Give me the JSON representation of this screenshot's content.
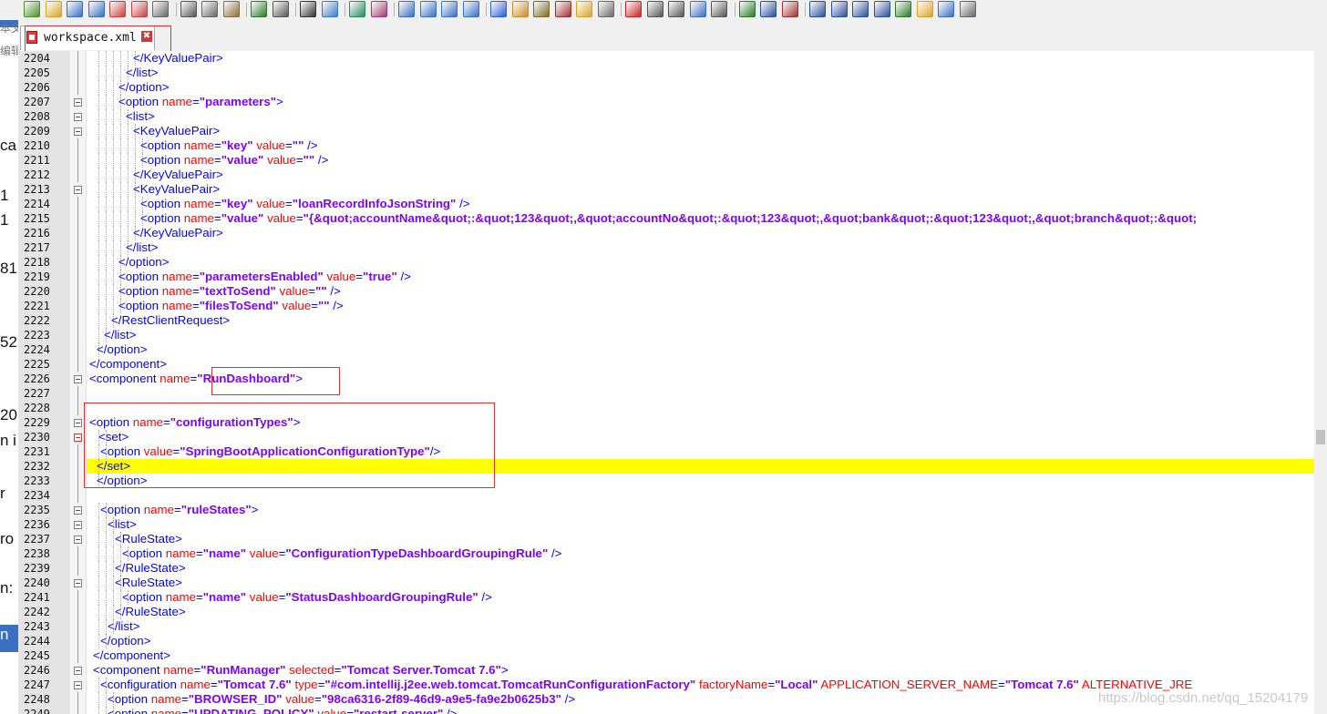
{
  "toolbar": {
    "icons": [
      "new-file-icon",
      "open-icon",
      "save-icon",
      "save-all-icon",
      "close-icon",
      "close-all-icon",
      "print-icon",
      "cut-icon",
      "copy-icon",
      "paste-icon",
      "undo-icon",
      "redo-icon",
      "find-icon",
      "replace-icon",
      "zoom-in-icon",
      "zoom-out-icon",
      "sync-v-icon",
      "sync-h-icon",
      "word-wrap-icon",
      "show-all-chars-icon",
      "indent-guide-icon",
      "udl-icon",
      "function-list-icon",
      "doc-map-icon",
      "folder-icon",
      "monitor-icon",
      "record-macro-icon",
      "stop-macro-icon",
      "play-macro-icon",
      "run-macro-icon",
      "save-macro-icon",
      "xml-tools-icon",
      "pretty-print-icon",
      "check-xml-icon",
      "collapse-icon",
      "up-icon",
      "down-icon",
      "expand-icon",
      "tree-icon",
      "folder-open-icon",
      "terminal-icon",
      "plugin-icon"
    ]
  },
  "tab": {
    "label": "workspace.xml",
    "close_glyph": "✖"
  },
  "left_strip": [
    "本文",
    "编辑(",
    "ca",
    "1",
    "1",
    "81",
    "52",
    "20",
    "n i",
    "r",
    "ro",
    "n:",
    "n"
  ],
  "editor": {
    "highlight_color": "#ffff00",
    "lines": [
      {
        "no": "2204",
        "fold": false,
        "ind": 48,
        "segs": [
          {
            "c": "t",
            "t": "</KeyValuePair>"
          }
        ]
      },
      {
        "no": "2205",
        "fold": false,
        "ind": 40,
        "segs": [
          {
            "c": "t",
            "t": "</list>"
          }
        ]
      },
      {
        "no": "2206",
        "fold": false,
        "ind": 32,
        "segs": [
          {
            "c": "t",
            "t": "</option>"
          }
        ]
      },
      {
        "no": "2207",
        "fold": true,
        "ind": 32,
        "segs": [
          {
            "c": "t",
            "t": "<option "
          },
          {
            "c": "a",
            "t": "name"
          },
          {
            "c": "t",
            "t": "="
          },
          {
            "c": "v",
            "t": "\"parameters\""
          },
          {
            "c": "t",
            "t": ">"
          }
        ]
      },
      {
        "no": "2208",
        "fold": true,
        "ind": 40,
        "segs": [
          {
            "c": "t",
            "t": "<list>"
          }
        ]
      },
      {
        "no": "2209",
        "fold": true,
        "ind": 48,
        "segs": [
          {
            "c": "t",
            "t": "<KeyValuePair>"
          }
        ]
      },
      {
        "no": "2210",
        "fold": false,
        "ind": 56,
        "segs": [
          {
            "c": "t",
            "t": "<option "
          },
          {
            "c": "a",
            "t": "name"
          },
          {
            "c": "t",
            "t": "="
          },
          {
            "c": "v",
            "t": "\"key\""
          },
          {
            "c": "t",
            "t": " "
          },
          {
            "c": "a",
            "t": "value"
          },
          {
            "c": "t",
            "t": "="
          },
          {
            "c": "v",
            "t": "\"\""
          },
          {
            "c": "t",
            "t": " />"
          }
        ]
      },
      {
        "no": "2211",
        "fold": false,
        "ind": 56,
        "segs": [
          {
            "c": "t",
            "t": "<option "
          },
          {
            "c": "a",
            "t": "name"
          },
          {
            "c": "t",
            "t": "="
          },
          {
            "c": "v",
            "t": "\"value\""
          },
          {
            "c": "t",
            "t": " "
          },
          {
            "c": "a",
            "t": "value"
          },
          {
            "c": "t",
            "t": "="
          },
          {
            "c": "v",
            "t": "\"\""
          },
          {
            "c": "t",
            "t": " />"
          }
        ]
      },
      {
        "no": "2212",
        "fold": false,
        "ind": 48,
        "segs": [
          {
            "c": "t",
            "t": "</KeyValuePair>"
          }
        ]
      },
      {
        "no": "2213",
        "fold": true,
        "ind": 48,
        "segs": [
          {
            "c": "t",
            "t": "<KeyValuePair>"
          }
        ]
      },
      {
        "no": "2214",
        "fold": false,
        "ind": 56,
        "segs": [
          {
            "c": "t",
            "t": "<option "
          },
          {
            "c": "a",
            "t": "name"
          },
          {
            "c": "t",
            "t": "="
          },
          {
            "c": "v",
            "t": "\"key\""
          },
          {
            "c": "t",
            "t": " "
          },
          {
            "c": "a",
            "t": "value"
          },
          {
            "c": "t",
            "t": "="
          },
          {
            "c": "v",
            "t": "\"loanRecordInfoJsonString\""
          },
          {
            "c": "t",
            "t": " />"
          }
        ]
      },
      {
        "no": "2215",
        "fold": false,
        "ind": 56,
        "segs": [
          {
            "c": "t",
            "t": "<option "
          },
          {
            "c": "a",
            "t": "name"
          },
          {
            "c": "t",
            "t": "="
          },
          {
            "c": "v",
            "t": "\"value\""
          },
          {
            "c": "t",
            "t": " "
          },
          {
            "c": "a",
            "t": "value"
          },
          {
            "c": "t",
            "t": "="
          },
          {
            "c": "v",
            "t": "\"{&quot;accountName&quot;:&quot;123&quot;,&quot;accountNo&quot;:&quot;123&quot;,&quot;bank&quot;:&quot;123&quot;,&quot;branch&quot;:&quot;"
          }
        ]
      },
      {
        "no": "2216",
        "fold": false,
        "ind": 48,
        "segs": [
          {
            "c": "t",
            "t": "</KeyValuePair>"
          }
        ]
      },
      {
        "no": "2217",
        "fold": false,
        "ind": 40,
        "segs": [
          {
            "c": "t",
            "t": "</list>"
          }
        ]
      },
      {
        "no": "2218",
        "fold": false,
        "ind": 32,
        "segs": [
          {
            "c": "t",
            "t": "</option>"
          }
        ]
      },
      {
        "no": "2219",
        "fold": false,
        "ind": 32,
        "segs": [
          {
            "c": "t",
            "t": "<option "
          },
          {
            "c": "a",
            "t": "name"
          },
          {
            "c": "t",
            "t": "="
          },
          {
            "c": "v",
            "t": "\"parametersEnabled\""
          },
          {
            "c": "t",
            "t": " "
          },
          {
            "c": "a",
            "t": "value"
          },
          {
            "c": "t",
            "t": "="
          },
          {
            "c": "v",
            "t": "\"true\""
          },
          {
            "c": "t",
            "t": " />"
          }
        ]
      },
      {
        "no": "2220",
        "fold": false,
        "ind": 32,
        "segs": [
          {
            "c": "t",
            "t": "<option "
          },
          {
            "c": "a",
            "t": "name"
          },
          {
            "c": "t",
            "t": "="
          },
          {
            "c": "v",
            "t": "\"textToSend\""
          },
          {
            "c": "t",
            "t": " "
          },
          {
            "c": "a",
            "t": "value"
          },
          {
            "c": "t",
            "t": "="
          },
          {
            "c": "v",
            "t": "\"\""
          },
          {
            "c": "t",
            "t": " />"
          }
        ]
      },
      {
        "no": "2221",
        "fold": false,
        "ind": 32,
        "segs": [
          {
            "c": "t",
            "t": "<option "
          },
          {
            "c": "a",
            "t": "name"
          },
          {
            "c": "t",
            "t": "="
          },
          {
            "c": "v",
            "t": "\"filesToSend\""
          },
          {
            "c": "t",
            "t": " "
          },
          {
            "c": "a",
            "t": "value"
          },
          {
            "c": "t",
            "t": "="
          },
          {
            "c": "v",
            "t": "\"\""
          },
          {
            "c": "t",
            "t": " />"
          }
        ]
      },
      {
        "no": "2222",
        "fold": false,
        "ind": 24,
        "segs": [
          {
            "c": "t",
            "t": "</RestClientRequest>"
          }
        ]
      },
      {
        "no": "2223",
        "fold": false,
        "ind": 16,
        "segs": [
          {
            "c": "t",
            "t": "</list>"
          }
        ]
      },
      {
        "no": "2224",
        "fold": false,
        "ind": 8,
        "segs": [
          {
            "c": "t",
            "t": "</option>"
          }
        ]
      },
      {
        "no": "2225",
        "fold": false,
        "ind": 0,
        "segs": [
          {
            "c": "t",
            "t": "</component>"
          }
        ]
      },
      {
        "no": "2226",
        "fold": true,
        "ind": 0,
        "segs": [
          {
            "c": "t",
            "t": "<component "
          },
          {
            "c": "a",
            "t": "name"
          },
          {
            "c": "t",
            "t": "="
          },
          {
            "c": "v",
            "t": "\"RunDashboard\""
          },
          {
            "c": "t",
            "t": ">"
          }
        ]
      },
      {
        "no": "2227",
        "fold": false,
        "ind": 0,
        "segs": []
      },
      {
        "no": "2228",
        "fold": false,
        "ind": 0,
        "segs": []
      },
      {
        "no": "2229",
        "fold": true,
        "ind": 0,
        "segs": [
          {
            "c": "t",
            "t": "<option "
          },
          {
            "c": "a",
            "t": "name"
          },
          {
            "c": "t",
            "t": "="
          },
          {
            "c": "v",
            "t": "\"configurationTypes\""
          },
          {
            "c": "t",
            "t": ">"
          }
        ]
      },
      {
        "no": "2230",
        "fold": true,
        "active": true,
        "ind": 10,
        "segs": [
          {
            "c": "t",
            "t": "<set>"
          }
        ]
      },
      {
        "no": "2231",
        "fold": false,
        "ind": 12,
        "segs": [
          {
            "c": "t",
            "t": "<option "
          },
          {
            "c": "a",
            "t": "value"
          },
          {
            "c": "t",
            "t": "="
          },
          {
            "c": "v",
            "t": "\"SpringBootApplicationConfigurationType\""
          },
          {
            "c": "t",
            "t": "/>"
          }
        ]
      },
      {
        "no": "2232",
        "fold": false,
        "ind": 8,
        "hl": true,
        "segs": [
          {
            "c": "t",
            "t": "</set>"
          }
        ]
      },
      {
        "no": "2233",
        "fold": false,
        "ind": 8,
        "segs": [
          {
            "c": "t",
            "t": "</option>"
          }
        ]
      },
      {
        "no": "2234",
        "fold": false,
        "ind": 0,
        "segs": []
      },
      {
        "no": "2235",
        "fold": true,
        "ind": 12,
        "segs": [
          {
            "c": "t",
            "t": "<option "
          },
          {
            "c": "a",
            "t": "name"
          },
          {
            "c": "t",
            "t": "="
          },
          {
            "c": "v",
            "t": "\"ruleStates\""
          },
          {
            "c": "t",
            "t": ">"
          }
        ]
      },
      {
        "no": "2236",
        "fold": true,
        "ind": 20,
        "segs": [
          {
            "c": "t",
            "t": "<list>"
          }
        ]
      },
      {
        "no": "2237",
        "fold": true,
        "ind": 28,
        "segs": [
          {
            "c": "t",
            "t": "<RuleState>"
          }
        ]
      },
      {
        "no": "2238",
        "fold": false,
        "ind": 36,
        "segs": [
          {
            "c": "t",
            "t": "<option "
          },
          {
            "c": "a",
            "t": "name"
          },
          {
            "c": "t",
            "t": "="
          },
          {
            "c": "v",
            "t": "\"name\""
          },
          {
            "c": "t",
            "t": " "
          },
          {
            "c": "a",
            "t": "value"
          },
          {
            "c": "t",
            "t": "="
          },
          {
            "c": "v",
            "t": "\"ConfigurationTypeDashboardGroupingRule\""
          },
          {
            "c": "t",
            "t": " />"
          }
        ]
      },
      {
        "no": "2239",
        "fold": false,
        "ind": 28,
        "segs": [
          {
            "c": "t",
            "t": "</RuleState>"
          }
        ]
      },
      {
        "no": "2240",
        "fold": true,
        "ind": 28,
        "segs": [
          {
            "c": "t",
            "t": "<RuleState>"
          }
        ]
      },
      {
        "no": "2241",
        "fold": false,
        "ind": 36,
        "segs": [
          {
            "c": "t",
            "t": "<option "
          },
          {
            "c": "a",
            "t": "name"
          },
          {
            "c": "t",
            "t": "="
          },
          {
            "c": "v",
            "t": "\"name\""
          },
          {
            "c": "t",
            "t": " "
          },
          {
            "c": "a",
            "t": "value"
          },
          {
            "c": "t",
            "t": "="
          },
          {
            "c": "v",
            "t": "\"StatusDashboardGroupingRule\""
          },
          {
            "c": "t",
            "t": " />"
          }
        ]
      },
      {
        "no": "2242",
        "fold": false,
        "ind": 28,
        "segs": [
          {
            "c": "t",
            "t": "</RuleState>"
          }
        ]
      },
      {
        "no": "2243",
        "fold": false,
        "ind": 20,
        "segs": [
          {
            "c": "t",
            "t": "</list>"
          }
        ]
      },
      {
        "no": "2244",
        "fold": false,
        "ind": 12,
        "segs": [
          {
            "c": "t",
            "t": "</option>"
          }
        ]
      },
      {
        "no": "2245",
        "fold": false,
        "ind": 4,
        "segs": [
          {
            "c": "t",
            "t": "</component>"
          }
        ]
      },
      {
        "no": "2246",
        "fold": true,
        "ind": 4,
        "segs": [
          {
            "c": "t",
            "t": "<component "
          },
          {
            "c": "a",
            "t": "name"
          },
          {
            "c": "t",
            "t": "="
          },
          {
            "c": "v",
            "t": "\"RunManager\""
          },
          {
            "c": "t",
            "t": " "
          },
          {
            "c": "a",
            "t": "selected"
          },
          {
            "c": "t",
            "t": "="
          },
          {
            "c": "v",
            "t": "\"Tomcat Server.Tomcat 7.6\""
          },
          {
            "c": "t",
            "t": ">"
          }
        ]
      },
      {
        "no": "2247",
        "fold": true,
        "ind": 12,
        "segs": [
          {
            "c": "t",
            "t": "<configuration "
          },
          {
            "c": "a",
            "t": "name"
          },
          {
            "c": "t",
            "t": "="
          },
          {
            "c": "v",
            "t": "\"Tomcat 7.6\""
          },
          {
            "c": "t",
            "t": " "
          },
          {
            "c": "a",
            "t": "type"
          },
          {
            "c": "t",
            "t": "="
          },
          {
            "c": "v",
            "t": "\"#com.intellij.j2ee.web.tomcat.TomcatRunConfigurationFactory\""
          },
          {
            "c": "t",
            "t": " "
          },
          {
            "c": "a",
            "t": "factoryName"
          },
          {
            "c": "t",
            "t": "="
          },
          {
            "c": "v",
            "t": "\"Local\""
          },
          {
            "c": "t",
            "t": " "
          },
          {
            "c": "a",
            "t": "APPLICATION_SERVER_NAME"
          },
          {
            "c": "t",
            "t": "="
          },
          {
            "c": "v",
            "t": "\"Tomcat 7.6\""
          },
          {
            "c": "t",
            "t": " "
          },
          {
            "c": "a",
            "t": "ALTERNATIVE_JRE"
          }
        ]
      },
      {
        "no": "2248",
        "fold": false,
        "ind": 20,
        "segs": [
          {
            "c": "t",
            "t": "<option "
          },
          {
            "c": "a",
            "t": "name"
          },
          {
            "c": "t",
            "t": "="
          },
          {
            "c": "v",
            "t": "\"BROWSER_ID\""
          },
          {
            "c": "t",
            "t": " "
          },
          {
            "c": "a",
            "t": "value"
          },
          {
            "c": "t",
            "t": "="
          },
          {
            "c": "v",
            "t": "\"98ca6316-2f89-46d9-a9e5-fa9e2b0625b3\""
          },
          {
            "c": "t",
            "t": " />"
          }
        ]
      },
      {
        "no": "2249",
        "fold": false,
        "ind": 20,
        "segs": [
          {
            "c": "t",
            "t": "<option "
          },
          {
            "c": "a",
            "t": "name"
          },
          {
            "c": "t",
            "t": "="
          },
          {
            "c": "v",
            "t": "\"UPDATING_POLICY\""
          },
          {
            "c": "t",
            "t": " "
          },
          {
            "c": "a",
            "t": "value"
          },
          {
            "c": "t",
            "t": "="
          },
          {
            "c": "v",
            "t": "\"restart-server\""
          },
          {
            "c": "t",
            "t": " />"
          }
        ]
      }
    ]
  },
  "watermark": "https://blog.csdn.net/qq_15204179"
}
